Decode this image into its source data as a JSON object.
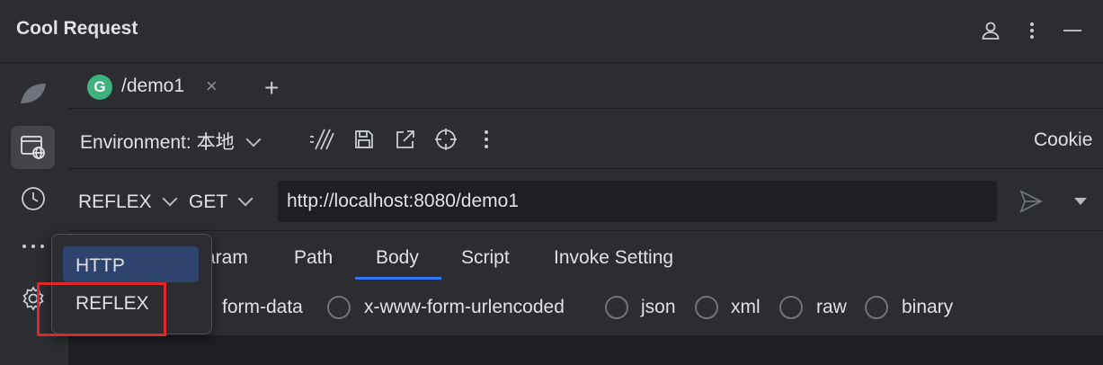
{
  "app": {
    "title": "Cool Request"
  },
  "tabs": [
    {
      "badge": "G",
      "label": "/demo1",
      "close": "×",
      "add": "+"
    }
  ],
  "env": {
    "label": "Environment:",
    "value": "本地"
  },
  "cookie_label": "Cookie",
  "request": {
    "mode": "REFLEX",
    "method": "GET",
    "url": "http://localhost:8080/demo1"
  },
  "subtabs": [
    "aram",
    "Path",
    "Body",
    "Script",
    "Invoke Setting"
  ],
  "active_subtab": "Body",
  "body_types": [
    "form-data",
    "x-www-form-urlencoded",
    "json",
    "xml",
    "raw",
    "binary"
  ],
  "mode_menu": {
    "items": [
      "HTTP",
      "REFLEX"
    ],
    "highlighted": "HTTP"
  },
  "colors": {
    "accent": "#3574f0",
    "highlight": "#e0262b",
    "badge": "#3fb27f"
  }
}
